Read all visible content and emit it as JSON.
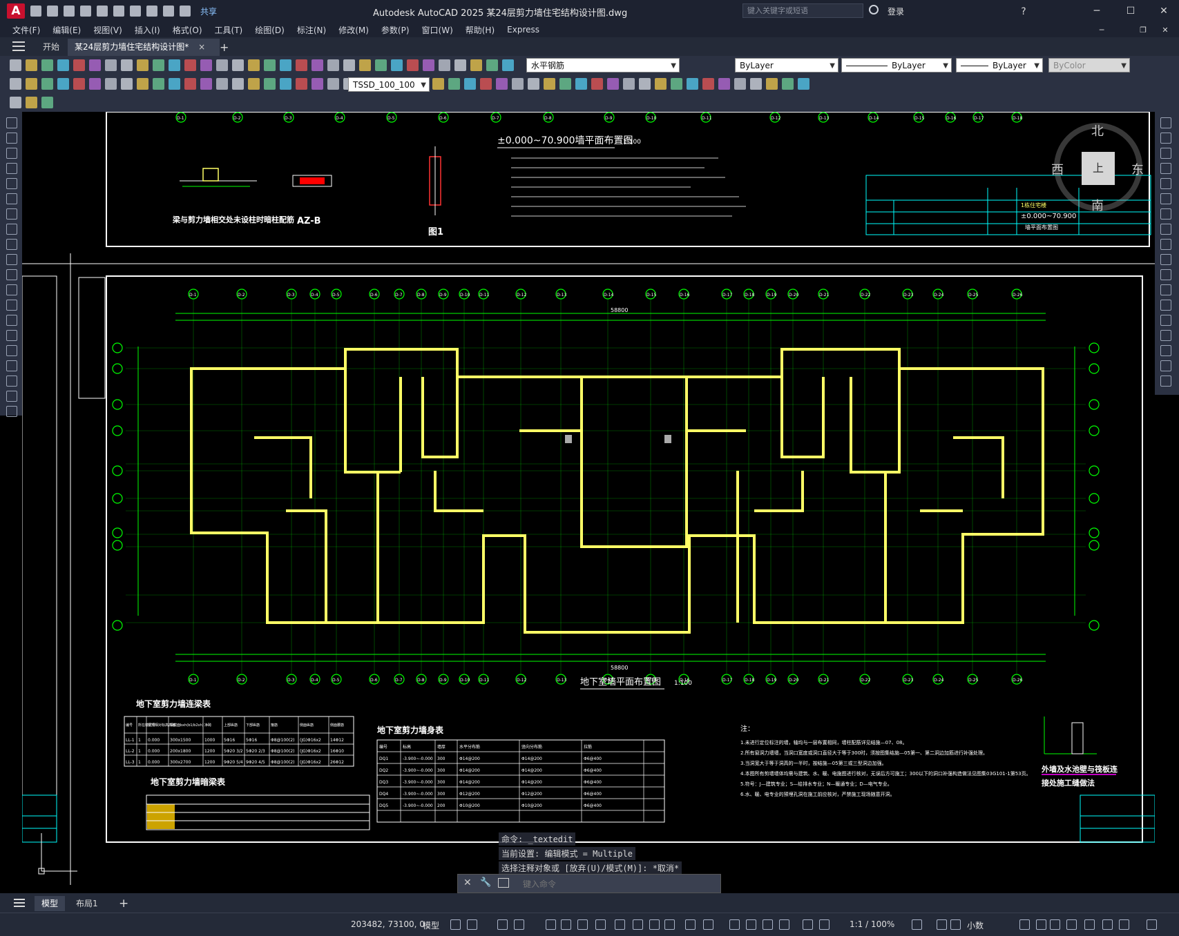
{
  "app": {
    "logo_letter": "A",
    "share_label": "共享",
    "window_title": "Autodesk AutoCAD 2025    某24层剪力墙住宅结构设计图.dwg",
    "search_placeholder": "键入关键字或短语",
    "login_label": "登录",
    "help_label": "?"
  },
  "menu": [
    "文件(F)",
    "编辑(E)",
    "视图(V)",
    "插入(I)",
    "格式(O)",
    "工具(T)",
    "绘图(D)",
    "标注(N)",
    "修改(M)",
    "参数(P)",
    "窗口(W)",
    "帮助(H)",
    "Express"
  ],
  "tabs": {
    "start": "开始",
    "active": "某24层剪力墙住宅结构设计图*",
    "close": "×",
    "add": "+"
  },
  "toolbar": {
    "layer_name": "水平钢筋",
    "color": "ByLayer",
    "linetype": "ByLayer",
    "lineweight": "ByLayer",
    "plotstyle": "ByColor",
    "dimstyle": "TSSD_100_100"
  },
  "viewcube": {
    "north": "北",
    "south": "南",
    "east": "东",
    "west": "西",
    "top": "上"
  },
  "drawing": {
    "top_plan_title": "±0.000~70.900墙平面布置图",
    "top_plan_scale": "1:100",
    "detail_note_1": "梁与剪力墙相交处未设柱时暗柱配筋",
    "detail_azb": "AZ-B",
    "detail_fig1": "图1",
    "main_plan_title": "地下室墙平面布置图",
    "main_plan_scale": "1:100",
    "total_dim": "58800",
    "beam_table_title": "地下室剪力墙连梁表",
    "hidden_beam_title": "地下室剪力墙暗梁表",
    "wall_table_title": "地下室剪力墙身表",
    "notes_title": "注：",
    "outer_wall_title": "外墙及水池壁与筏板连",
    "outer_wall_sub": "接处施工缝做法",
    "titleblock_name": "±0.000~70.900",
    "titleblock_sub": "墙平面布置图",
    "titleblock_project": "1栋住宅楼"
  },
  "beam_table": {
    "headers": [
      "编号",
      "所在楼层号",
      "梁顶相对标高高差",
      "梁截面bxh(b1/b2xh)",
      "净跨",
      "上部纵筋",
      "下部纵筋",
      "箍筋",
      "侧面纵筋",
      "侧面腰筋"
    ],
    "rows": [
      [
        "LL-1",
        "1",
        "0.000",
        "300x1500",
        "1000",
        "5Φ16",
        "5Φ16",
        "Φ8@100(2)",
        "(JG)Φ16x2",
        "14Φ12"
      ],
      [
        "LL-2",
        "1",
        "0.000",
        "200x1800",
        "1200",
        "5Φ20 3/2",
        "5Φ20 2/3",
        "Φ8@100(2)",
        "(JG)Φ16x2",
        "16Φ10"
      ],
      [
        "LL-3",
        "1",
        "0.000",
        "300x2700",
        "1200",
        "9Φ20 5/4",
        "9Φ20 4/5",
        "Φ8@100(2)",
        "(JG)Φ16x2",
        "26Φ12"
      ]
    ]
  },
  "wall_table": {
    "headers": [
      "编号",
      "标高",
      "墙厚",
      "水平分布筋",
      "竖向分布筋",
      "拉筋"
    ],
    "rows": [
      [
        "DQ1",
        "-3.900~-0.000",
        "300",
        "Φ14@200",
        "Φ14@200",
        "Φ6@400"
      ],
      [
        "DQ2",
        "-3.900~-0.000",
        "300",
        "Φ14@200",
        "Φ14@200",
        "Φ6@400"
      ],
      [
        "DQ3",
        "-3.900~-0.000",
        "300",
        "Φ14@200",
        "Φ14@200",
        "Φ6@400"
      ],
      [
        "DQ4",
        "-3.900~-0.000",
        "300",
        "Φ12@200",
        "Φ12@200",
        "Φ6@400"
      ],
      [
        "DQ5",
        "-3.900~-0.000",
        "200",
        "Φ10@200",
        "Φ10@200",
        "Φ6@400"
      ]
    ]
  },
  "notes": [
    "1.未进行定位标注的墙，轴均与一层布置相同，墙柱配筋详见结施—07、08。",
    "2.所有窗洞力墙墙，当洞口宽度或洞口直径大于等于300时，须按图集结施—05第一、第二洞边加筋进行补强处理。",
    "3.当洞宽大于等于洞高的一半时，按结施—05第三或三型洞边加强。",
    "4.本图所有剪墙墙体均需与建筑、水、暖、电施图进行核对，无误后方可施工；300以下的洞口补强构造做法见图集03G101-1第53页。",
    "5.符号：J—建筑专业；S—给排水专业；N—暖通专业；D—电气专业。",
    "6.水、暖、电专业的预埋孔洞在施工前应核对，严禁施工现场随意开洞。"
  ],
  "command": {
    "history": [
      "命令: _textedit",
      "当前设置: 编辑模式 = Multiple",
      "选择注释对象或 [放弃(U)/模式(M)]: *取消*"
    ],
    "placeholder": "键入命令"
  },
  "layouts": {
    "model": "模型",
    "layout1": "布局1",
    "add": "+"
  },
  "status": {
    "coordinates": "203482, 73100, 0",
    "space": "模型",
    "scale": "1:1 / 100%",
    "units": "小数"
  },
  "axis_labels_top": [
    "D-1",
    "D-2",
    "D-3",
    "D-4",
    "D-5",
    "D-6",
    "D-7",
    "D-8",
    "D-9",
    "D-10",
    "D-11",
    "D-12",
    "D-13",
    "D-14",
    "D-15",
    "D-16",
    "D-17",
    "D-18",
    "D-19",
    "D-20",
    "D-21",
    "D-22",
    "D-23",
    "D-24",
    "D-25",
    "D-26",
    "D-27"
  ]
}
